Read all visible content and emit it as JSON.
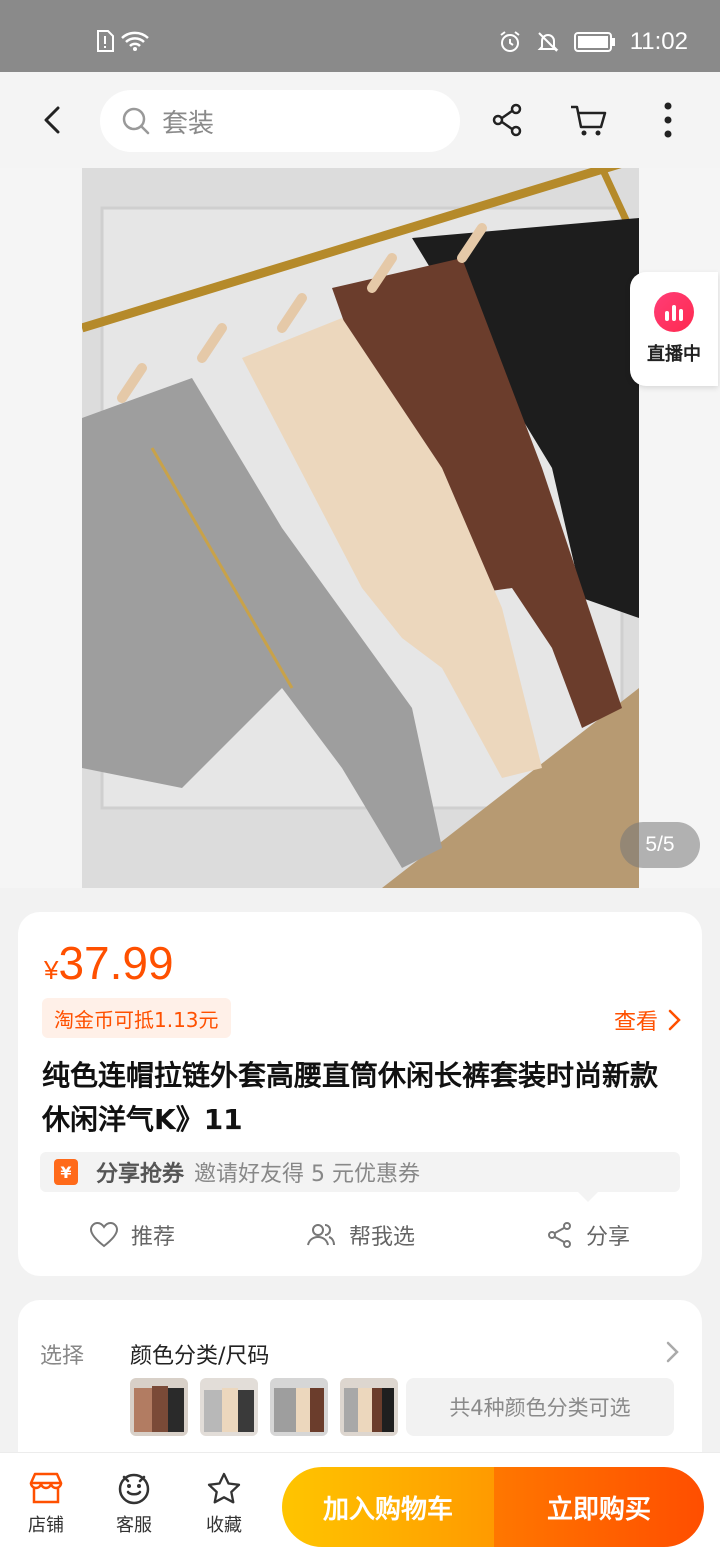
{
  "status_bar": {
    "time": "11:02"
  },
  "header": {
    "search_placeholder": "套装"
  },
  "image": {
    "page_indicator": "5/5",
    "live_label": "直播中"
  },
  "product": {
    "currency": "¥",
    "price": "37.99",
    "coin_tag": "淘金币可抵1.13元",
    "view_label": "查看",
    "title": "纯色连帽拉链外套高腰直筒休闲长裤套装时尚新款休闲洋气K》11",
    "coupon_icon": "¥",
    "coupon_title": "分享抢券",
    "coupon_desc": "邀请好友得 5 元优惠券",
    "actions": {
      "recommend": "推荐",
      "help_choose": "帮我选",
      "share": "分享"
    }
  },
  "select": {
    "label": "选择",
    "title": "颜色分类/尺码",
    "variant_summary": "共4种颜色分类可选"
  },
  "bottom_bar": {
    "store": "店铺",
    "service": "客服",
    "favorite": "收藏",
    "add_to_cart": "加入购物车",
    "buy_now": "立即购买"
  },
  "colors": {
    "accent": "#ff5000",
    "cart_start": "#ffc500",
    "buy_end": "#ff4e00"
  }
}
